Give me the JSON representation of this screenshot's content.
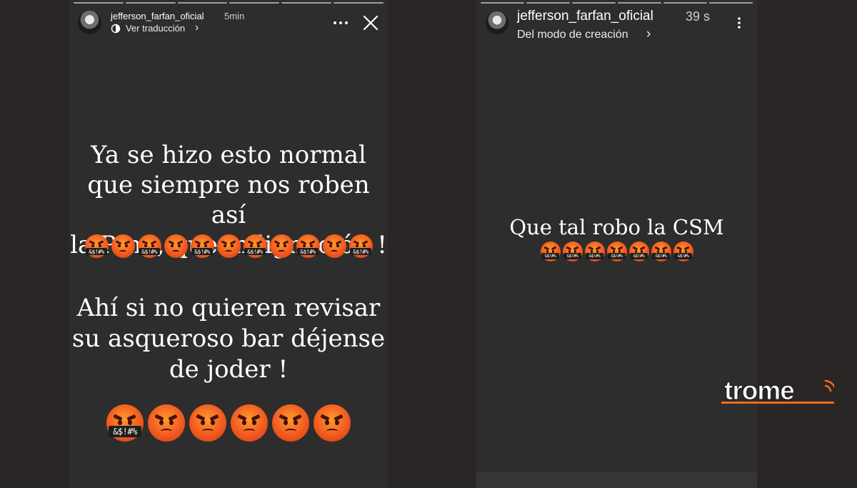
{
  "left_story": {
    "username": "jefferson_farfan_oficial",
    "time": "5min",
    "translate_label": "Ver traducción",
    "translate_chevron": "›",
    "more_icon": "more-horizontal-icon",
    "close_icon": "close-icon",
    "text_1": [
      "Ya se hizo esto normal",
      "que siempre nos roben así",
      "la Ptm , que indignación !"
    ],
    "emoji_row_1": [
      "cursing",
      "angry",
      "cursing",
      "angry",
      "cursing",
      "angry",
      "cursing",
      "angry",
      "cursing",
      "angry",
      "cursing"
    ],
    "text_2": [
      "Ahí si no quieren revisar",
      "su asqueroso bar déjense",
      "de joder !"
    ],
    "emoji_row_2": [
      "cursing",
      "angry",
      "angry",
      "angry",
      "angry",
      "angry"
    ]
  },
  "right_story": {
    "username": "jefferson_farfan_oficial",
    "time": "39 s",
    "creation_label": "Del modo de creación",
    "creation_chevron": "›",
    "more_icon": "more-vertical-icon",
    "text": "Que tal robo la CSM",
    "emoji_row": [
      "cursing",
      "cursing",
      "cursing",
      "cursing",
      "cursing",
      "cursing",
      "cursing"
    ]
  },
  "grawlix": "&$!#%",
  "watermark": "trome",
  "colors": {
    "background": "#2b2626",
    "story_bg": "#2d2d2d",
    "logo_orange": "#f26b22",
    "emoji_orange": "#f25a20"
  }
}
